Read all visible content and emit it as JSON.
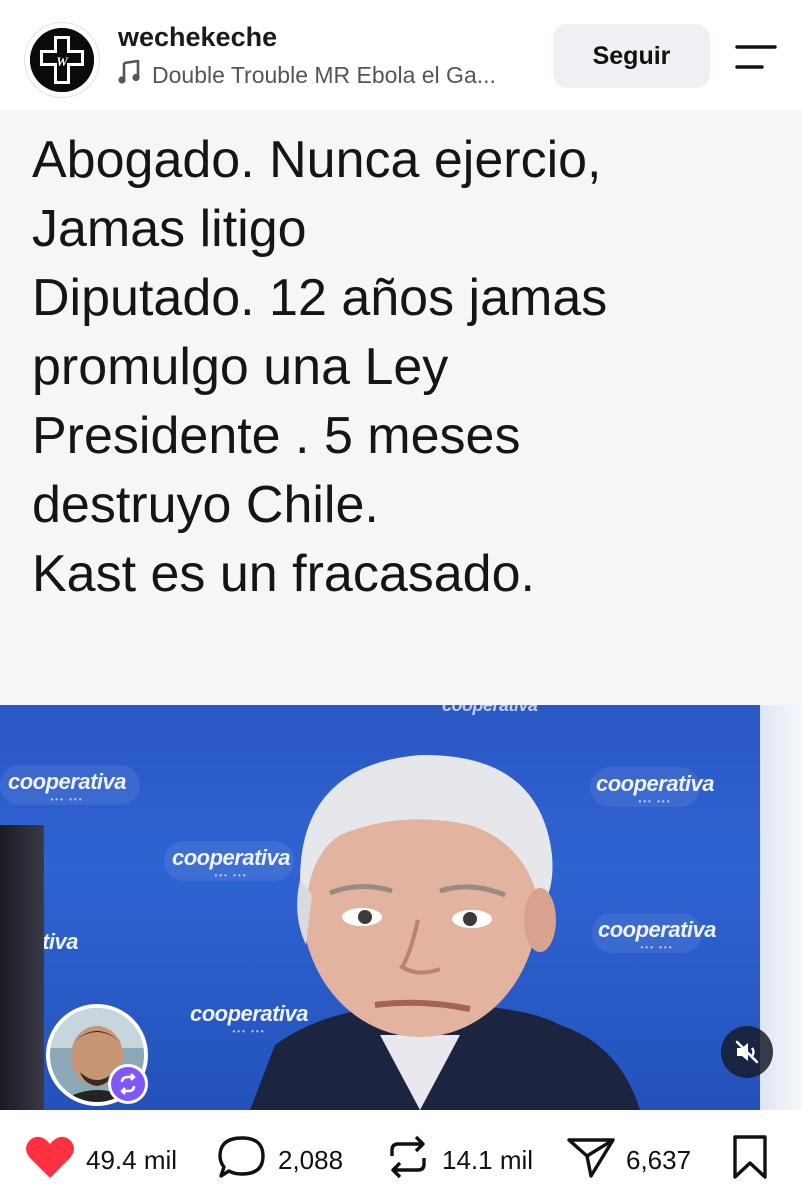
{
  "header": {
    "username": "wechekeche",
    "music": "Double Trouble MR Ebola el Ga...",
    "follow_label": "Seguir",
    "avatar_icon": "skull-cross-logo-icon",
    "menu_icon": "menu-icon"
  },
  "post": {
    "lines": [
      "Abogado. Nunca ejercio,",
      "Jamas litigo",
      "Diputado. 12 años jamas",
      "promulgo una Ley",
      "Presidente . 5 meses",
      "destruyo Chile.",
      "Kast es un fracasado."
    ],
    "watermark": "cooperativa"
  },
  "actions": {
    "likes": "49.4 mil",
    "comments": "2,088",
    "reposts": "14.1 mil",
    "shares": "6,637"
  },
  "colors": {
    "like": "#ff3040",
    "repost_badge": "#7e57ff",
    "background": "#ffffff"
  }
}
